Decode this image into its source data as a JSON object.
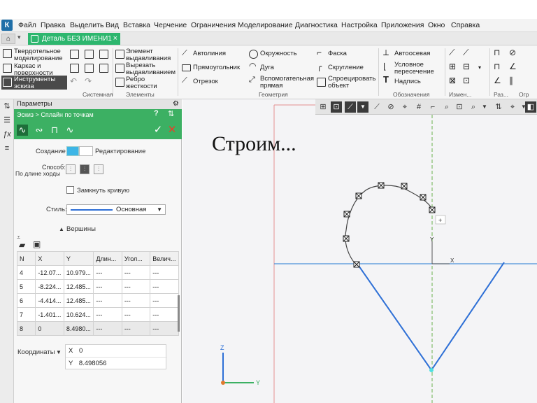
{
  "menu": [
    "Файл",
    "Правка",
    "Выделить",
    "Вид",
    "Вставка",
    "Черчение",
    "Ограничения",
    "Моделирование",
    "Диагностика",
    "Настройка",
    "Приложения",
    "Окно",
    "Справка"
  ],
  "document_tab": {
    "title": "Деталь БЕЗ ИМЕНИ1",
    "close": "×"
  },
  "ribbon": {
    "modes": [
      "Твердотельное моделирование",
      "Каркас и поверхности",
      "Инструменты эскиза"
    ],
    "system_label": "Системная",
    "elements": [
      "Элемент выдавливания",
      "Вырезать выдавливанием",
      "Ребро жесткости"
    ],
    "elements_label": "Элементы",
    "geometry": [
      "Автолиния",
      "Прямоугольник",
      "Отрезок",
      "Окружность",
      "Дуга",
      "Вспомогательная прямая",
      "Фаска",
      "Скругление",
      "Спроецировать объект"
    ],
    "geometry_label": "Геометрия",
    "annotation": [
      "Автоосевая",
      "Условное пересечение",
      "Надпись"
    ],
    "annotation_label": "Обозначения",
    "edit_label": "Измен...",
    "size_label": "Раз...",
    "constraint_label": "Огр"
  },
  "panel": {
    "title": "Параметры",
    "breadcrumb": "Эскиз > Сплайн по точкам",
    "creation_label": "Создание",
    "editing_label": "Редактирование",
    "method_label": "Способ:",
    "method_sub": "По длине хорды",
    "close_curve_label": "Замкнуть кривую",
    "style_label": "Стиль:",
    "style_value": "Основная",
    "vertices_label": "Вершины",
    "coordinates_label": "Координаты",
    "coord_x_label": "X",
    "coord_x": "0",
    "coord_y_label": "Y",
    "coord_y": "8.498056"
  },
  "table": {
    "headers": [
      "N",
      "X",
      "Y",
      "Длин...",
      "Угол...",
      "Велич..."
    ],
    "rows": [
      [
        "4",
        "-12.07...",
        "10.979...",
        "---",
        "---",
        "---"
      ],
      [
        "5",
        "-8.224...",
        "12.485...",
        "---",
        "---",
        "---"
      ],
      [
        "6",
        "-4.414...",
        "12.485...",
        "---",
        "---",
        "---"
      ],
      [
        "7",
        "-1.401...",
        "10.624...",
        "---",
        "---",
        "---"
      ],
      [
        "8",
        "0",
        "8.4980...",
        "---",
        "---",
        "---"
      ]
    ]
  },
  "canvas": {
    "caption": "Строим...",
    "axis_labels": {
      "x": "X",
      "y": "Y",
      "z": "Z"
    }
  },
  "colors": {
    "accent_green": "#3cb063",
    "sketch_blue": "#2d6fd6",
    "create_blue": "#3db5e6"
  }
}
